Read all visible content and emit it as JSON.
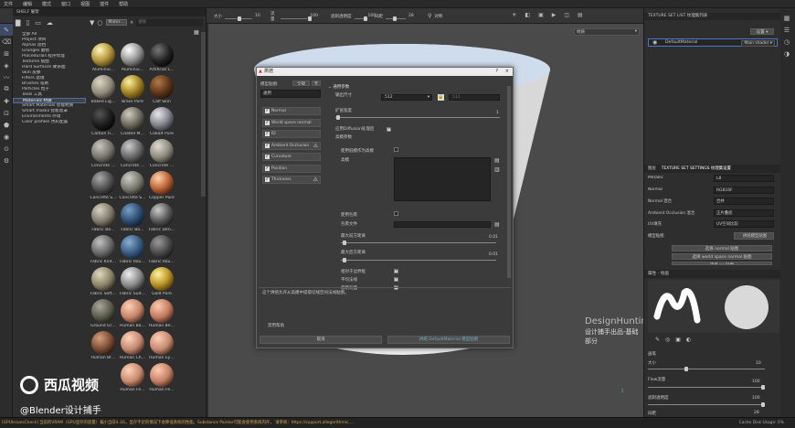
{
  "menu": [
    "文件",
    "编辑",
    "模式",
    "窗口",
    "视图",
    "插件",
    "帮助"
  ],
  "toolbar": {
    "size_label": "大小",
    "size_value": "10",
    "flow_label": "流量",
    "flow_value": "100",
    "opacity_label": "遮刺透明度",
    "opacity_value": "100",
    "angle_label": "间距",
    "angle_value": "28",
    "sym_label": "对称",
    "viewport_mode": "材质"
  },
  "shelf": {
    "title": "SHELF 展架",
    "search_placeholder": "搜索",
    "filter_chip": "Mater…",
    "tree": [
      "全部 All",
      "Project 项目",
      "Alphas 遮挡",
      "Grunges 磨损",
      "Procedurals 程序纹理",
      "Textures 贴图",
      "Hard Surfaces 硬表面",
      "Skin 皮肤",
      "Filters 滤镜",
      "Brushes 笔刷",
      "Particles 粒子",
      "Tools 工具",
      "Materials 材质",
      "Smart Materials 智能材质",
      "Smart masks 智能遮罩",
      "Environments 环境",
      "Color profiles 色彩配置"
    ],
    "materials": [
      "Aluminiu…",
      "Aluminiu…",
      "Artificial L…",
      "Baked Lig…",
      "Brass Pure",
      "Calf Skin",
      "Carbon Fi…",
      "Coated M…",
      "Cobalt Pure",
      "Concrete …",
      "Concrete …",
      "Concrete …",
      "Concrete S…",
      "Concrete S…",
      "Copper Pure",
      "Fabric Ba…",
      "Fabric Ba…",
      "Fabric Den…",
      "Fabric Knit…",
      "Fabric Rou…",
      "Fabric Rou…",
      "Fabric Soft…",
      "Fabric Suit…",
      "Gold Pure",
      "Ground Gr…",
      "Human Ba…",
      "Human Be…",
      "Human Br…",
      "Human Ch…",
      "Human Ey…",
      "",
      "Human Fe…",
      "Human Fe…"
    ]
  },
  "dialog": {
    "title": "烘焙",
    "mesh_maps_label": "模型贴图:",
    "all_btn": "全部",
    "none_btn": "无",
    "common_item": "通用",
    "maps": [
      "Normal",
      "World space normal",
      "ID",
      "Ambient Occlusion",
      "Curvature",
      "Position",
      "Thickness"
    ],
    "section": "通用参数",
    "out_size_label": "输出尺寸",
    "out_size_value": "512",
    "out_size_value2": "512",
    "dilation_label": "扩张宽度",
    "dilation_value": "1",
    "diffusion_label": "应用Diffusion处理后",
    "mesh_label": "高模参数",
    "use_lowpoly_label": "使用低模作为高模",
    "highpoly_label": "高模",
    "use_cage_label": "使用包裹",
    "cage_file_label": "包裹文件",
    "max_front_label": "最大前方距离",
    "max_front_value": "0.01",
    "max_rear_label": "最大后方距离",
    "max_rear_value": "0.01",
    "relative_label": "相对于边界框",
    "average_label": "平均法线",
    "ignore_label": "忽略背面",
    "description": "这个烘焙允许从高模中提取切线空间法线贴图。",
    "cancel_btn": "取消",
    "bake_btn": "烘焙 DefaultMaterial 模型贴图",
    "disable_help": "禁用帮助"
  },
  "right": {
    "tsl_title": "TEXTURE SET LIST 纹理集列表",
    "settings_btn": "设置",
    "default_material": "DefaultMaterial",
    "main_shader": "Main shader",
    "tabs": [
      "图层",
      "TEXTURE SET SETTINGS 纹理集设置"
    ],
    "rows": [
      [
        "Metallic",
        "L8"
      ],
      [
        "Normal",
        "RGB16F"
      ],
      [
        "Normal 混合",
        "合并"
      ],
      [
        "Ambient Occlusion 混合",
        "正片叠底"
      ],
      [
        "UV填充",
        "UV空间比较"
      ],
      [
        "模型贴图",
        "烘焙模型贴图"
      ]
    ],
    "btn_normal": "选择 normal 贴图",
    "btn_wsn": "选择 world space normal 贴图",
    "btn_ao": "选择 ao 贴图",
    "prop_title": "属性 - 绘画",
    "brush_label": "画笔",
    "size_label": "大小",
    "size_value": "10",
    "flow_label": "Flow流量",
    "flow_value": "100",
    "opacity_label": "遮刺透明度",
    "opacity_value": "100",
    "spacing_label": "间距",
    "spacing_value": "28"
  },
  "watermark": {
    "brand": "DesignHunting",
    "sub": "设计捕手出品-基础部分",
    "app": "西瓜视频",
    "user": "@Blender设计捕手"
  },
  "status": {
    "text": "[GPUIssuesCheck] 当前的VRAM（GPU显存的容量）偏小当前4.3G，显存不足的情况下会降低系统的性能。Substance Painter可能会使用系统内存，  请参阅：https://support.allegorithmic.…",
    "cache": "Cache Disk Usage:  0%"
  },
  "colors": {
    "accent": "#4a78c8",
    "warn": "#d6a64c"
  }
}
